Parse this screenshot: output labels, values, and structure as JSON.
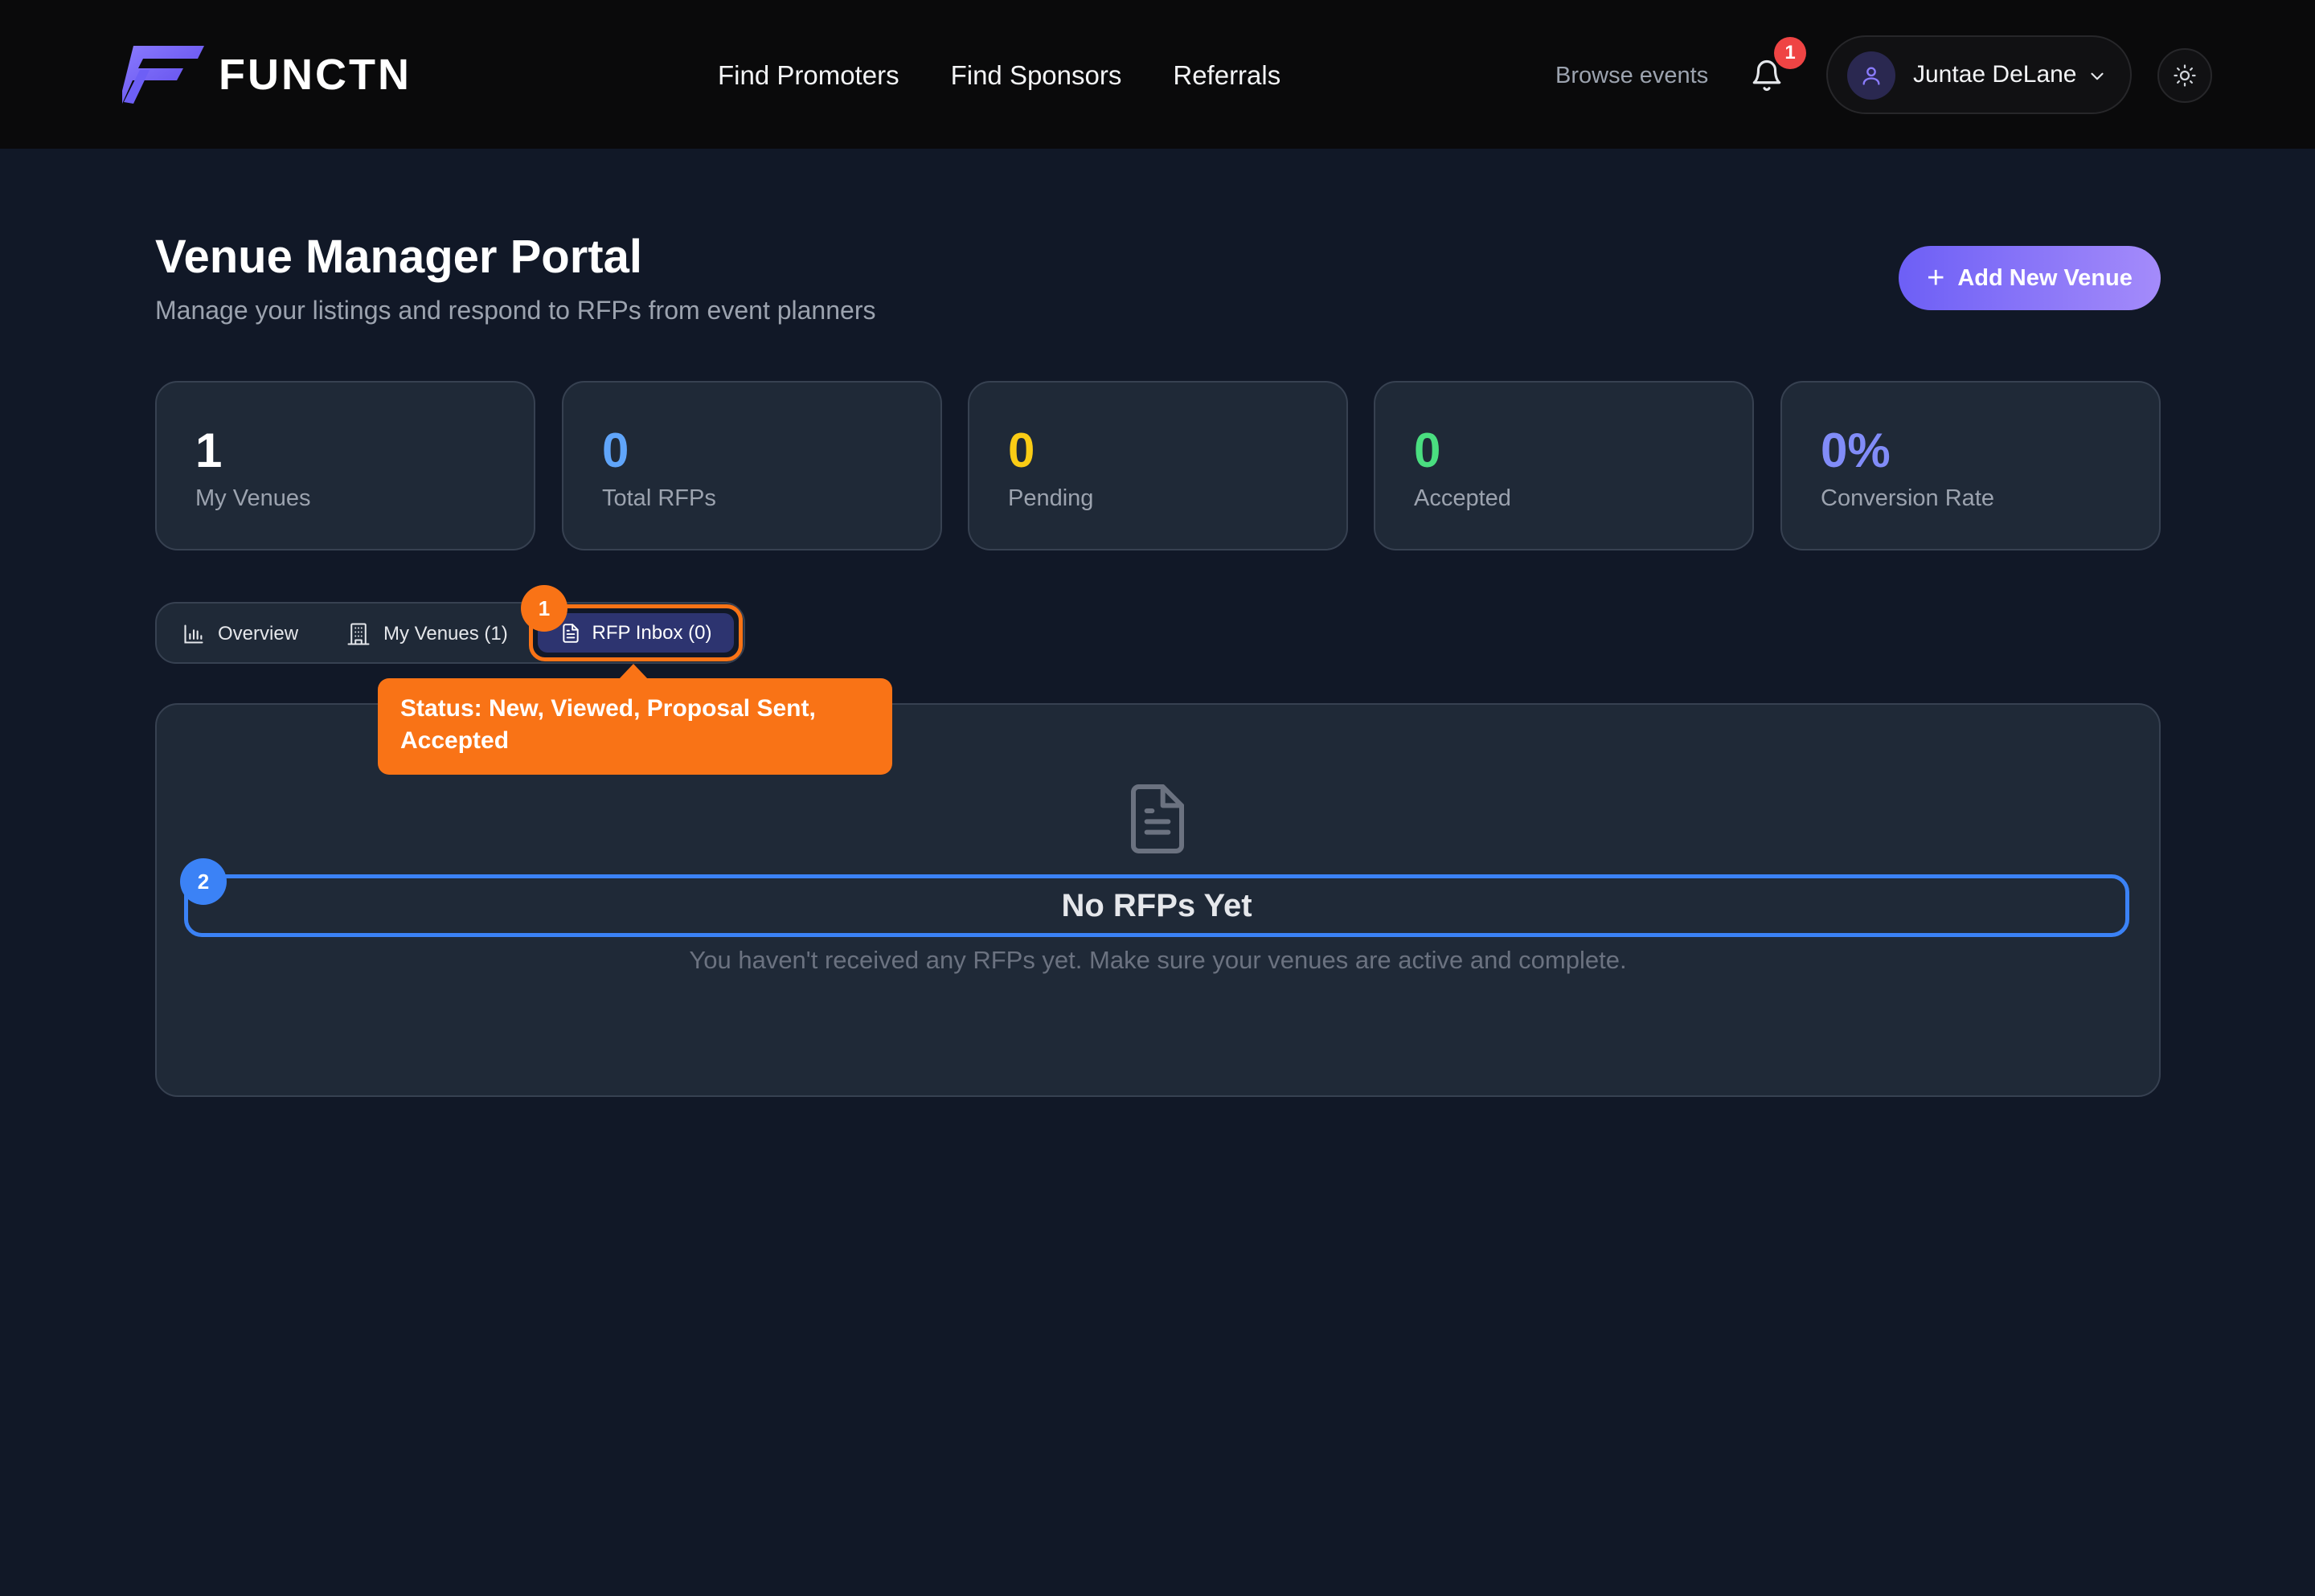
{
  "brand": {
    "name": "FUNCTN",
    "accent": "#6d5ff6"
  },
  "nav": {
    "items": [
      "Find Promoters",
      "Find Sponsors",
      "Referrals"
    ]
  },
  "header": {
    "browse_label": "Browse events",
    "notification_count": "1",
    "user_name": "Juntae DeLane"
  },
  "page": {
    "title": "Venue Manager Portal",
    "subtitle": "Manage your listings and respond to RFPs from event planners",
    "add_button_label": "Add New Venue"
  },
  "stats": [
    {
      "value": "1",
      "label": "My Venues",
      "color": "#ffffff"
    },
    {
      "value": "0",
      "label": "Total RFPs",
      "color": "#60a5fa"
    },
    {
      "value": "0",
      "label": "Pending",
      "color": "#facc15"
    },
    {
      "value": "0",
      "label": "Accepted",
      "color": "#4ade80"
    },
    {
      "value": "0%",
      "label": "Conversion Rate",
      "color": "#818cf8"
    }
  ],
  "tabs": [
    {
      "label": "Overview",
      "icon": "bar-chart-icon"
    },
    {
      "label": "My Venues (1)",
      "icon": "building-icon"
    },
    {
      "label": "RFP Inbox (0)",
      "icon": "file-text-icon",
      "active": true
    }
  ],
  "annotations": {
    "marker_1": "1",
    "marker_2": "2",
    "tooltip": "Status: New, Viewed, Proposal Sent, Accepted"
  },
  "empty_state": {
    "icon": "file-text-icon",
    "title": "No RFPs Yet",
    "description": "You haven't received any RFPs yet. Make sure your venues are active and complete."
  }
}
